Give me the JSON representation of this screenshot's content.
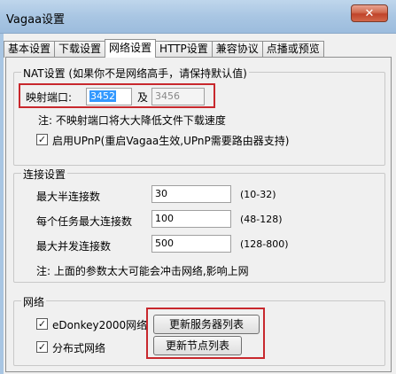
{
  "window": {
    "title": "Vagaa设置",
    "close_glyph": "✕"
  },
  "tabs": [
    {
      "label": "基本设置",
      "active": false
    },
    {
      "label": "下载设置",
      "active": false
    },
    {
      "label": "网络设置",
      "active": true
    },
    {
      "label": "HTTP设置",
      "active": false
    },
    {
      "label": "兼容协议",
      "active": false
    },
    {
      "label": "点播或预览",
      "active": false
    }
  ],
  "nat": {
    "legend": "NAT设置 (如果你不是网络高手，请保持默认值)",
    "port_label": "映射端口:",
    "port_value": "3452",
    "and_label": "及",
    "port2_value": "3456",
    "note": "注: 不映射端口将大大降低文件下载速度",
    "upnp_checked": true,
    "upnp_label": "启用UPnP(重启Vagaa生效,UPnP需要路由器支持)"
  },
  "connection": {
    "legend": "连接设置",
    "rows": [
      {
        "label": "最大半连接数",
        "value": "30",
        "range": "(10-32)"
      },
      {
        "label": "每个任务最大连接数",
        "value": "100",
        "range": "(48-128)"
      },
      {
        "label": "最大并发连接数",
        "value": "500",
        "range": "(128-800)"
      }
    ],
    "note": "注: 上面的参数太大可能会冲击网络,影响上网"
  },
  "network": {
    "legend": "网络",
    "edonkey_checked": true,
    "edonkey_label": "eDonkey2000网络",
    "edonkey_button": "更新服务器列表",
    "dist_checked": true,
    "dist_label": "分布式网络",
    "dist_button": "更新节点列表"
  },
  "colors": {
    "highlight": "#c8282d",
    "selection": "#3399ff"
  }
}
